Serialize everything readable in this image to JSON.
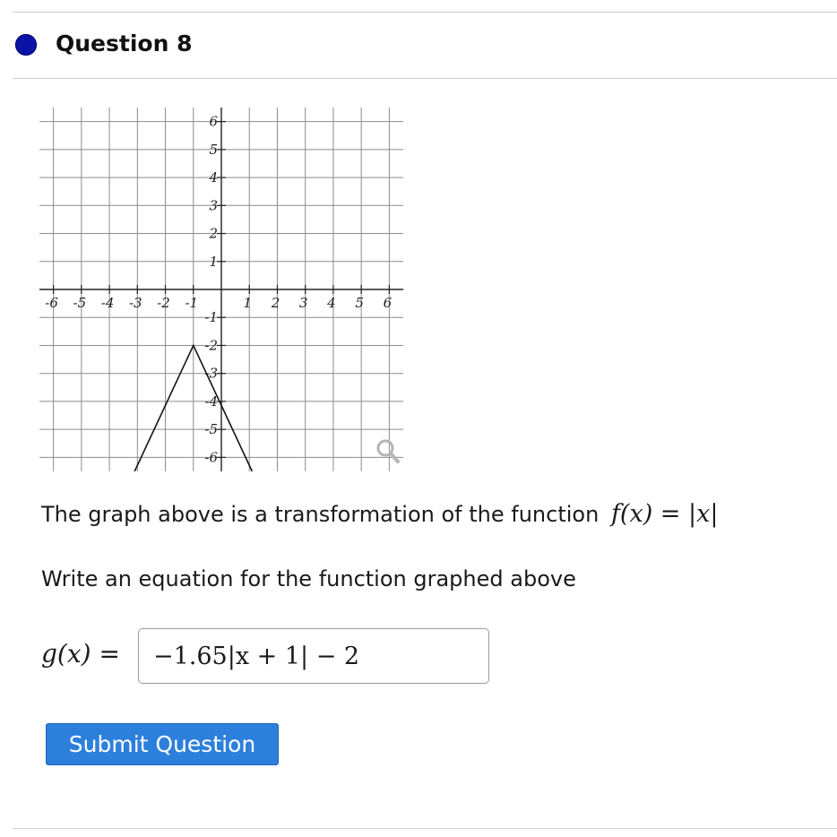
{
  "question": {
    "title": "Question 8",
    "status_color": "#0a13a6"
  },
  "prompt": {
    "line1_text": "The graph above is a transformation of the function",
    "line1_math": "f(x) = |x|",
    "line2_text": "Write an equation for the function graphed above"
  },
  "answer": {
    "label": "g(x) =",
    "value": "−1.65|x + 1| − 2"
  },
  "submit": {
    "label": "Submit Question",
    "color": "#2d7fdc"
  },
  "graph": {
    "zoom_icon": "magnifier-icon",
    "x_ticks": [
      "-6",
      "-5",
      "-4",
      "-3",
      "-2",
      "-1",
      "1",
      "2",
      "3",
      "4",
      "5",
      "6"
    ],
    "y_ticks": [
      "6",
      "5",
      "4",
      "3",
      "2",
      "1",
      "-1",
      "-2",
      "-3",
      "-4",
      "-5",
      "-6"
    ]
  },
  "chart_data": {
    "type": "line",
    "xlim": [
      -6.5,
      6.5
    ],
    "ylim": [
      -6.5,
      6.5
    ],
    "grid": true,
    "series": [
      {
        "x": [
          -3.1,
          -1,
          1.1
        ],
        "y": [
          -6.5,
          -2,
          -6.5
        ]
      }
    ]
  }
}
